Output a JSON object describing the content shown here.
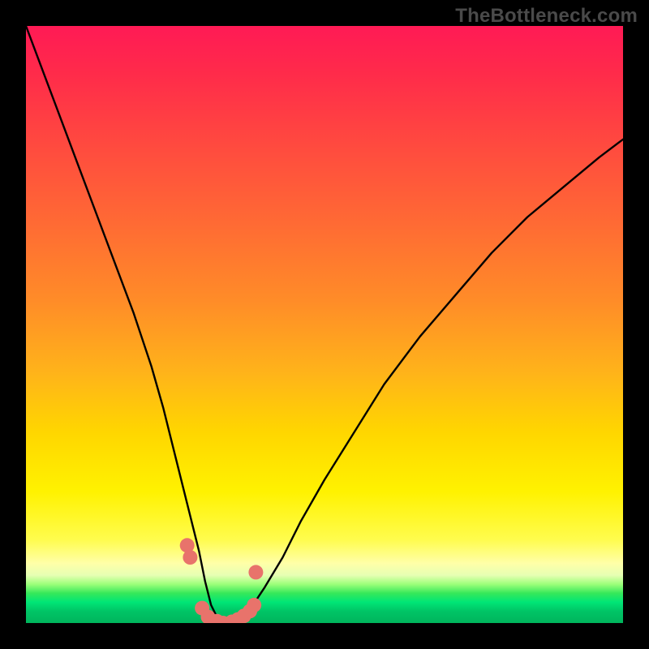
{
  "watermark": "TheBottleneck.com",
  "colors": {
    "curve": "#000000",
    "markers": "#e8736b",
    "frame": "#000000"
  },
  "chart_data": {
    "type": "line",
    "title": "",
    "xlabel": "",
    "ylabel": "",
    "xlim": [
      0,
      100
    ],
    "ylim": [
      0,
      100
    ],
    "grid": false,
    "series": [
      {
        "name": "bottleneck-curve",
        "x": [
          0,
          3,
          6,
          9,
          12,
          15,
          18,
          21,
          23,
          25,
          27,
          29,
          30,
          31,
          32,
          33,
          34,
          36,
          38,
          40,
          43,
          46,
          50,
          55,
          60,
          66,
          72,
          78,
          84,
          90,
          96,
          100
        ],
        "y": [
          100,
          92,
          84,
          76,
          68,
          60,
          52,
          43,
          36,
          28,
          20,
          12,
          7,
          3,
          1,
          0,
          0,
          1,
          3,
          6,
          11,
          17,
          24,
          32,
          40,
          48,
          55,
          62,
          68,
          73,
          78,
          81
        ]
      }
    ],
    "markers": {
      "name": "highlighted-points",
      "points": [
        {
          "x": 27.0,
          "y": 13.0
        },
        {
          "x": 27.5,
          "y": 11.0
        },
        {
          "x": 29.5,
          "y": 2.5
        },
        {
          "x": 30.5,
          "y": 1.0
        },
        {
          "x": 32.0,
          "y": 0.3
        },
        {
          "x": 33.0,
          "y": 0.0
        },
        {
          "x": 34.5,
          "y": 0.2
        },
        {
          "x": 35.5,
          "y": 0.6
        },
        {
          "x": 36.5,
          "y": 1.2
        },
        {
          "x": 37.5,
          "y": 2.0
        },
        {
          "x": 38.2,
          "y": 3.0
        },
        {
          "x": 38.5,
          "y": 8.5
        }
      ]
    }
  }
}
